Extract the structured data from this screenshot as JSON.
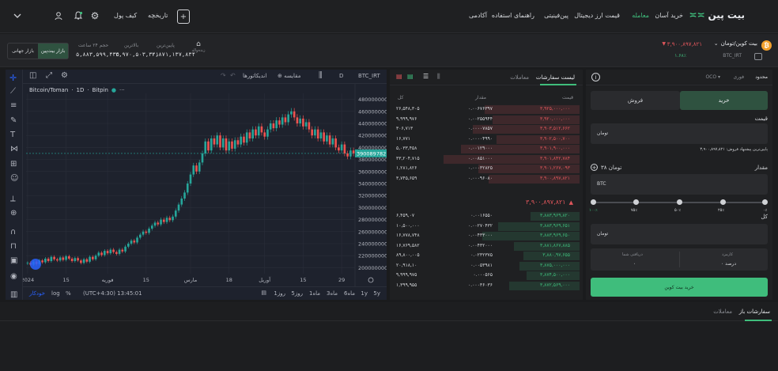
{
  "nav": {
    "logo": "بیت پین",
    "links": [
      "خرید آسان",
      "معامله",
      "قیمت ارز دیجیتال",
      "پین‌فینیتی",
      "راهنمای استفاده",
      "آکادمی"
    ],
    "active_index": 1,
    "wallet": "کیف پول",
    "history": "تاریخچه"
  },
  "ticker": {
    "pair_name": "بیت کوین/تومان",
    "symbol": "BTC_IRT",
    "price": "۳,۹۰۰,۸۹۷,۸۲۱",
    "change": "۱.۶۸٪",
    "stats": [
      {
        "label": "حجم ۲۴ ساعت",
        "value": "۵,۸۸۳,۵۹۹,۴۳۵"
      },
      {
        "label": "بالاترین",
        "value": "۳,۹۷۰,۵۰۳,۳۰۱"
      },
      {
        "label": "پایین‌ترین",
        "value": "۳,۸۷۱,۱۳۷,۸۳۴"
      }
    ],
    "live": "زنده‌واله",
    "market_global": "بازار جهانی",
    "market_bitpin": "بازار بیت‌پین"
  },
  "chart_toolbar": {
    "symbol": "BTC_IRT",
    "interval": "D",
    "compare": "مقایسه",
    "indicators": "اندیکاتورها"
  },
  "chart_data": {
    "type": "candlestick",
    "title": "Bitcoin/Toman",
    "interval_label": "1D",
    "source": "Bitpin",
    "current_price_tag": "3900897821",
    "y_ticks": [
      2000000000,
      2200000000,
      2400000000,
      2600000000,
      2800000000,
      3000000000,
      3200000000,
      3400000000,
      3600000000,
      3800000000,
      4000000000,
      4200000000,
      4400000000,
      4600000000,
      4800000000
    ],
    "ylim": [
      1900000000,
      4900000000
    ],
    "x_ticks": [
      {
        "label": "2024",
        "i": 0
      },
      {
        "label": "15",
        "i": 13
      },
      {
        "label": "فوریه",
        "i": 27
      },
      {
        "label": "15",
        "i": 40
      },
      {
        "label": "مارس",
        "i": 55
      },
      {
        "label": "18",
        "i": 68
      },
      {
        "label": "آوریل",
        "i": 80
      },
      {
        "label": "15",
        "i": 93
      },
      {
        "label": "29",
        "i": 106
      }
    ],
    "n": 111,
    "closes": [
      2080000000,
      2050000000,
      2100000000,
      2060000000,
      2120000000,
      2090000000,
      2150000000,
      2110000000,
      2180000000,
      2140000000,
      2120000000,
      2170000000,
      2130000000,
      2190000000,
      2150000000,
      2110000000,
      2160000000,
      2120000000,
      2080000000,
      2140000000,
      2100000000,
      2180000000,
      2140000000,
      2200000000,
      2250000000,
      2210000000,
      2280000000,
      2240000000,
      2300000000,
      2260000000,
      2230000000,
      2300000000,
      2270000000,
      2350000000,
      2400000000,
      2450000000,
      2420000000,
      2500000000,
      2550000000,
      2600000000,
      2580000000,
      2650000000,
      2700000000,
      2750000000,
      2720000000,
      2800000000,
      2760000000,
      2830000000,
      2790000000,
      2850000000,
      2950000000,
      3050000000,
      3150000000,
      3250000000,
      3400000000,
      3550000000,
      3700000000,
      3600000000,
      3750000000,
      3900000000,
      4100000000,
      3950000000,
      4150000000,
      4050000000,
      4200000000,
      4000000000,
      4150000000,
      3950000000,
      4100000000,
      3980000000,
      4120000000,
      4050000000,
      4180000000,
      4080000000,
      4250000000,
      4150000000,
      4300000000,
      4200000000,
      4350000000,
      4250000000,
      4180000000,
      4300000000,
      4400000000,
      4320000000,
      4450000000,
      4380000000,
      4500000000,
      4420000000,
      4550000000,
      4600000000,
      4500000000,
      4400000000,
      4480000000,
      4350000000,
      4420000000,
      4300000000,
      4200000000,
      4300000000,
      4150000000,
      4250000000,
      4100000000,
      4200000000,
      4050000000,
      4150000000,
      4000000000,
      3950000000,
      4050000000,
      3900000000,
      3850000000,
      3950000000,
      3900000000
    ]
  },
  "chart_footer": {
    "ranges": [
      "5y",
      "1y",
      "6ماه",
      "3ماه",
      "1ماه",
      "5روز",
      "1روز"
    ],
    "time": "(UTC+4:30) 13:45:01",
    "pct": "%",
    "log": "log",
    "auto": "خودکار"
  },
  "orderbook": {
    "tab_list": "لیست سفارشات",
    "tab_trades": "معاملات",
    "headers": {
      "price": "قیمت",
      "amount": "مقدار",
      "total": "کل"
    },
    "asks": [
      {
        "price": "۳,۹۲۵,۰۰۰,۰۰۰",
        "amount": "۰.۰۰۶۷۶۳۹۷",
        "total": "۲۶,۵۴۸,۳۰۵"
      },
      {
        "price": "۳,۹۲۰,۰۰۰,۰۰۰",
        "amount": "۰.۰۰۲۵۵۹۴۴",
        "total": "۹,۹۹۹,۹۷۶"
      },
      {
        "price": "۳,۹۰۳,۵۱۲,۶۶۲",
        "amount": "۰.۰۰۰۰۷۸۵۷",
        "total": "۳۰۶,۷۱۳"
      },
      {
        "price": "۳,۹۰۲,۵۰۰,۷۰۰",
        "amount": "۰.۰۰۰۰۴۹۹۰",
        "total": "۱۶,۷۷۱"
      },
      {
        "price": "۳,۹۰۱,۹۰۰,۰۰۰",
        "amount": "۰.۰۰۱۲۹۰۰۰",
        "total": "۵,۰۳۳,۴۵۸"
      },
      {
        "price": "۳,۹۰۱,۸۴۲,۷۸۴",
        "amount": "۰.۰۰۸۵۱۰۰۰",
        "total": "۳۳,۲۰۴,۷۱۵"
      },
      {
        "price": "۳,۹۰۱,۲۶۷,۰۹۳",
        "amount": "۰.۰۰۰۳۲۸۲۵",
        "total": "۱,۲۸۱,۸۲۶"
      },
      {
        "price": "۳,۹۰۰,۸۹۷,۸۲۱",
        "amount": "۰.۰۰۰۹۶۰۸۰",
        "total": "۳,۷۴۵,۶۵۹"
      }
    ],
    "mid_price": "۳,۹۰۰,۸۹۷,۸۲۱",
    "bids": [
      {
        "price": "۳,۸۸۳,۹۶۹,۸۲۰",
        "amount": "۰.۰۰۱۶۵۵۰",
        "total": "۶,۴۵۹,۰۷"
      },
      {
        "price": "۳,۸۸۳,۹۶۹,۶۵۱",
        "amount": "۰.۰۰۲۷۰۴۳۲",
        "total": "۱۰,۵۰۰,۰۰۰"
      },
      {
        "price": "۳,۸۸۳,۹۶۹,۶۵۰",
        "amount": "۰.۰۰۴۳۳۰۰۰",
        "total": "۱۶,۷۷۸,۷۴۸"
      },
      {
        "price": "۳,۸۸۱,۸۶۷,۸۸۵",
        "amount": "۰.۰۰۴۳۲۰۰۰",
        "total": "۱۶,۷۶۹,۵۸۲"
      },
      {
        "price": "۳,۸۸۰,۹۷,۶۵۵",
        "amount": "۰.۰۲۳۲۳۷۵",
        "total": "۸۹,۸۰۰,۰۰۵"
      },
      {
        "price": "۳,۸۷۵,۰۰۰,۰۰۰",
        "amount": "۰.۰۰۵۳۹۸۱",
        "total": "۲۰,۹۱۸,۱۰"
      },
      {
        "price": "۳,۸۷۴,۵۰۰,۰۰۰",
        "amount": "۰.۰۰۰۵۶۵",
        "total": "۹,۹۹۹,۹۷۵"
      },
      {
        "price": "۳,۸۷۲,۵۶۹,۰۰۰",
        "amount": "۰.۰۰۰۳۶۰۳۶",
        "total": "۱,۳۹۹,۹۵۵"
      }
    ]
  },
  "trade_form": {
    "tab_limit": "محدود",
    "tab_market": "فوری",
    "tab_oco": "OCO",
    "buy": "خرید",
    "sell": "فروش",
    "price_label": "قیمت",
    "price_unit": "تومان",
    "price_hint": "پایین‌ترین پیشنهاد فروش: ۳,۹۰۰,۸۹۷,۸۲۱",
    "amount_label": "مقدار",
    "balance": "۳۸ تومان",
    "amount_unit": "BTC",
    "slider_marks": [
      "۰٪",
      "۲۵٪",
      "۵۰٪",
      "۷۵٪",
      "۱۰۰٪"
    ],
    "total_label": "کل",
    "total_unit": "تومان",
    "fee_label": "کارمزد",
    "fee_value": "۰ درصد",
    "receive_label": "دریافتی شما",
    "receive_value": "۰",
    "submit": "خرید بیت کوین"
  },
  "bottom": {
    "tab_open": "سفارشات باز",
    "tab_trades": "معاملات"
  }
}
